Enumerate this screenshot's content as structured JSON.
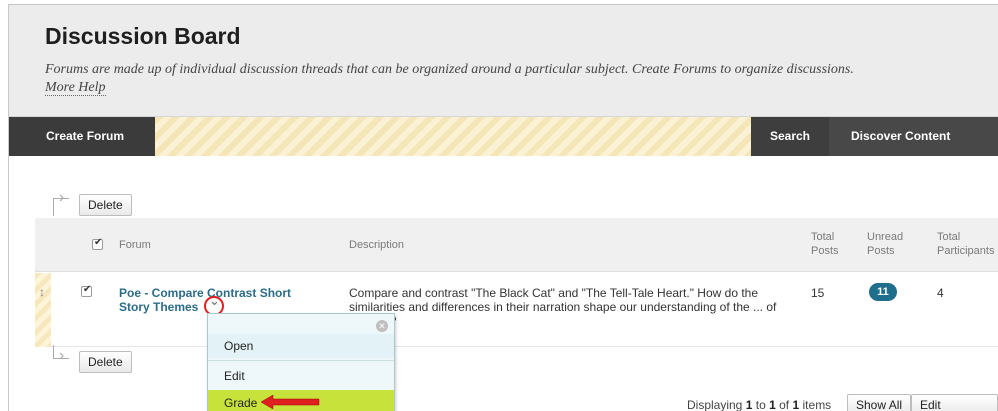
{
  "header": {
    "title": "Discussion Board",
    "subtitle": "Forums are made up of individual discussion threads that can be organized around a particular subject. Create Forums to organize discussions.",
    "more_help": "More Help"
  },
  "toolbar": {
    "create_forum": "Create Forum",
    "search": "Search",
    "discover_content": "Discover Content"
  },
  "actions": {
    "delete_label": "Delete"
  },
  "table": {
    "columns": {
      "forum": "Forum",
      "description": "Description",
      "total_posts_line1": "Total",
      "total_posts_line2": "Posts",
      "unread_posts_line1": "Unread",
      "unread_posts_line2": "Posts",
      "total_participants_line1": "Total",
      "total_participants_line2": "Participants"
    },
    "rows": [
      {
        "forum": "Poe - Compare Contrast Short Story Themes",
        "description": "Compare and contrast \"The Black Cat\" and \"The Tell-Tale Heart.\" How do the similarities and differences in their narration shape our understanding of the ... of insanity?",
        "total_posts": "15",
        "unread_posts": "11",
        "total_participants": "4"
      }
    ]
  },
  "context_menu": {
    "items": [
      "Open",
      "Edit",
      "Grade"
    ],
    "highlighted": "Grade"
  },
  "paging": {
    "prefix": "Displaying",
    "from": "1",
    "to_word": "to",
    "to": "1",
    "of_word": "of",
    "total": "1",
    "suffix": "items",
    "show_all": "Show All",
    "edit_paging": "Edit Paging..."
  },
  "colors": {
    "toolbar_bg": "#4a4a4a",
    "link": "#2b6c89",
    "badge": "#1f6e8c",
    "grade_highlight": "#c8e23c",
    "annotation_red": "#e02020"
  }
}
